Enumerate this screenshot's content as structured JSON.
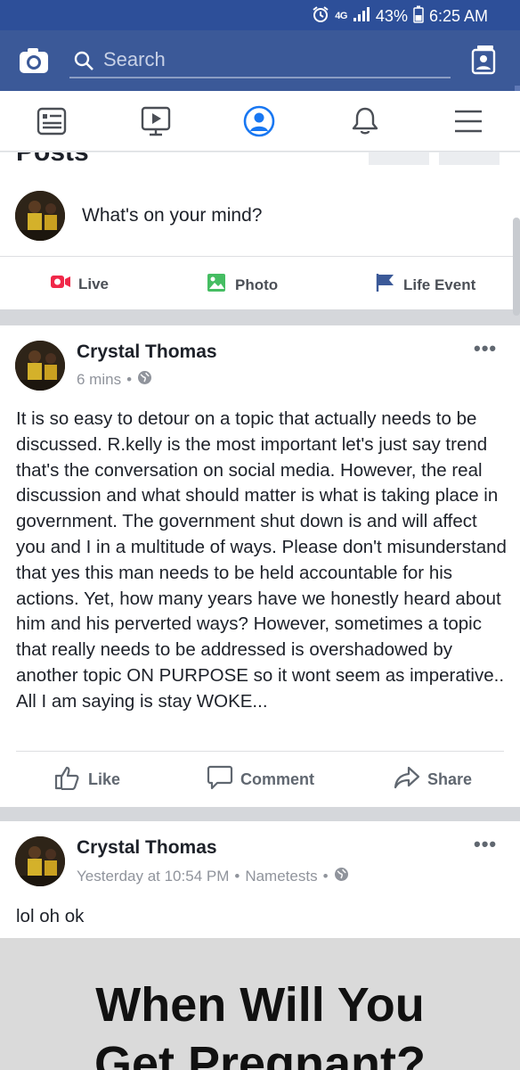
{
  "status_bar": {
    "network": "4G",
    "battery": "43%",
    "time": "6:25 AM"
  },
  "header": {
    "search_placeholder": "Search"
  },
  "nav": {
    "items": [
      "news-feed-icon",
      "watch-icon",
      "profile-icon",
      "notifications-icon",
      "menu-icon"
    ],
    "active_color": "#1877f2"
  },
  "profile": {
    "section_title_partial": "Posts"
  },
  "composer": {
    "prompt": "What's on your mind?",
    "actions": [
      {
        "label": "Live",
        "icon": "live-video-icon",
        "color": "#f02849"
      },
      {
        "label": "Photo",
        "icon": "photo-icon",
        "color": "#45bd62"
      },
      {
        "label": "Life Event",
        "icon": "flag-icon",
        "color": "#3b5998"
      }
    ]
  },
  "posts": [
    {
      "author": "Crystal Thomas",
      "time": "6 mins",
      "privacy": "globe-icon",
      "text": "It is so easy to detour on a topic that actually needs to be discussed. R.kelly is the most important let's just say trend that's the conversation on social media. However, the real discussion and what should matter is what is taking place in government. The government shut down is and will affect you and I in a multitude of ways. Please don't misunderstand that yes this man needs to be held accountable for his actions. Yet, how many years have we honestly heard about him and his perverted ways? However, sometimes a topic that really needs to be addressed is overshadowed by another topic ON PURPOSE so it wont seem as imperative.. All I am saying is stay WOKE...",
      "actions": [
        "Like",
        "Comment",
        "Share"
      ]
    },
    {
      "author": "Crystal Thomas",
      "time": "Yesterday at 10:54 PM",
      "app": "Nametests",
      "privacy": "globe-icon",
      "text": "lol oh ok",
      "link_image_title_line1": "When Will You",
      "link_image_title_line2": "Get Pregnant?"
    }
  ],
  "colors": {
    "header": "#3b5998",
    "status_bar": "#2d4f99",
    "meta": "#90949c"
  }
}
